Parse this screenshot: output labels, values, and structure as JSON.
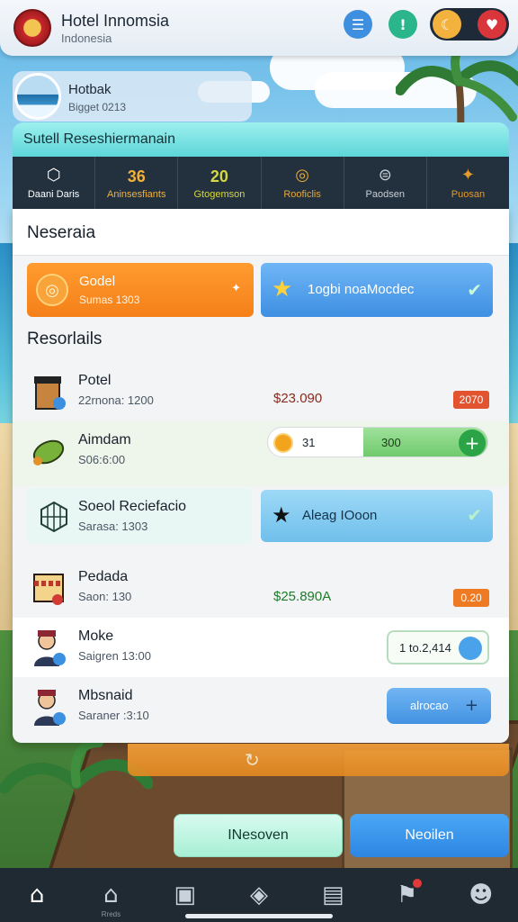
{
  "header": {
    "title": "Hotel Innomsia",
    "subtitle": "Indonesia"
  },
  "profile": {
    "name": "Hotbak",
    "sub": "Bigget 0213"
  },
  "panel_title": "Sutell Reseshiermanain",
  "stats": [
    {
      "label": "Daani Daris",
      "value": "",
      "icon": "cube-icon",
      "color": "#ffffff"
    },
    {
      "label": "Aninsesfiants",
      "value": "36",
      "icon": "",
      "color": "#f2b23a"
    },
    {
      "label": "Gtogemson",
      "value": "20",
      "icon": "",
      "color": "#d5d842"
    },
    {
      "label": "Rooficlis",
      "value": "",
      "icon": "target-icon",
      "color": "#e6a93a"
    },
    {
      "label": "Paodsen",
      "value": "",
      "icon": "coin-icon",
      "color": "#c8cfd6"
    },
    {
      "label": "Puosan",
      "value": "",
      "icon": "pin-icon",
      "color": "#e49a2d"
    }
  ],
  "section_head": "Neseraia",
  "hot_orange": {
    "title": "Godel",
    "sub": "Sumas 1303"
  },
  "hot_blue": {
    "title": "1ogbi noaMocdec"
  },
  "resources_title": "Resorlails",
  "rows": {
    "potel": {
      "name": "Potel",
      "sub": "22rnona: 1200",
      "price": "$23.090",
      "badge": "2070"
    },
    "aimdam": {
      "name": "Aimdam",
      "sub": "S06:6:00",
      "left_value": "31",
      "right_value": "300"
    },
    "special": {
      "name": "Soeol Reciefacio",
      "sub": "Sarasa: 1303",
      "button": "Aleag IOoon"
    },
    "pedada": {
      "name": "Pedada",
      "sub": "Saon: 130",
      "price": "$25.890A",
      "badge": "0.20"
    },
    "moke": {
      "name": "Moke",
      "sub": "Saigren 13:00",
      "field_value": "1 to.2,414"
    },
    "mbsnaid": {
      "name": "Mbsnaid",
      "sub": "Saraner :3:10",
      "button": "alrocao"
    }
  },
  "footer": {
    "left_button": "INesoven",
    "right_button": "Neoilen"
  },
  "tabs": [
    {
      "name": "home",
      "label": ""
    },
    {
      "name": "lodging",
      "label": "Rreds"
    },
    {
      "name": "rooms",
      "label": ""
    },
    {
      "name": "map",
      "label": ""
    },
    {
      "name": "shop",
      "label": ""
    },
    {
      "name": "alerts",
      "label": ""
    },
    {
      "name": "staff",
      "label": ""
    }
  ]
}
